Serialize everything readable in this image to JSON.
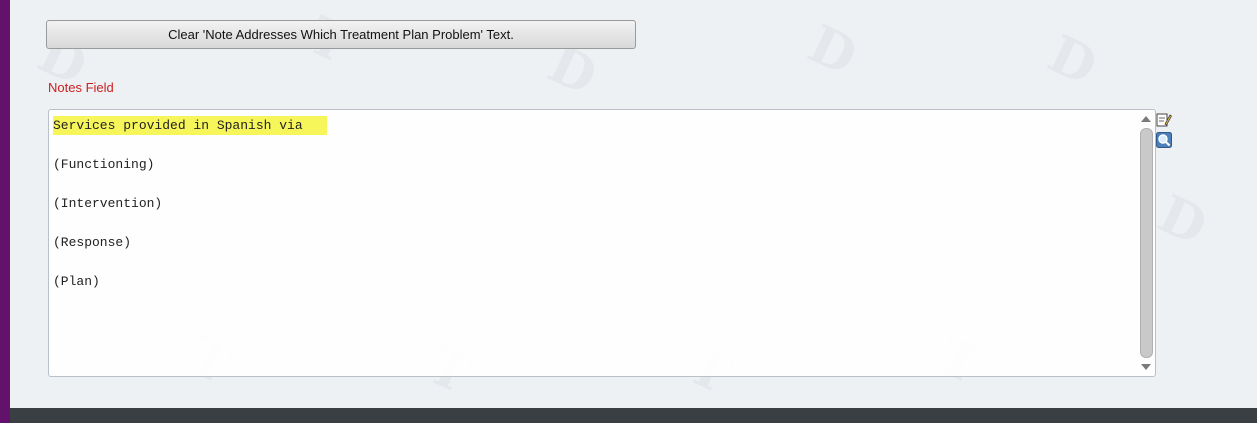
{
  "buttons": {
    "clear_label": "Clear 'Note Addresses Which Treatment Plan Problem' Text."
  },
  "notes": {
    "label": "Notes Field",
    "lines": [
      "Services provided in Spanish via",
      "(Functioning)",
      "(Intervention)",
      "(Response)",
      "(Plan)"
    ]
  },
  "icons": {
    "edit": "edit-note-icon",
    "zoom": "zoom-icon"
  },
  "colors": {
    "frame": "#62126a",
    "label": "#cc2020",
    "highlight": "#f6f55a"
  }
}
